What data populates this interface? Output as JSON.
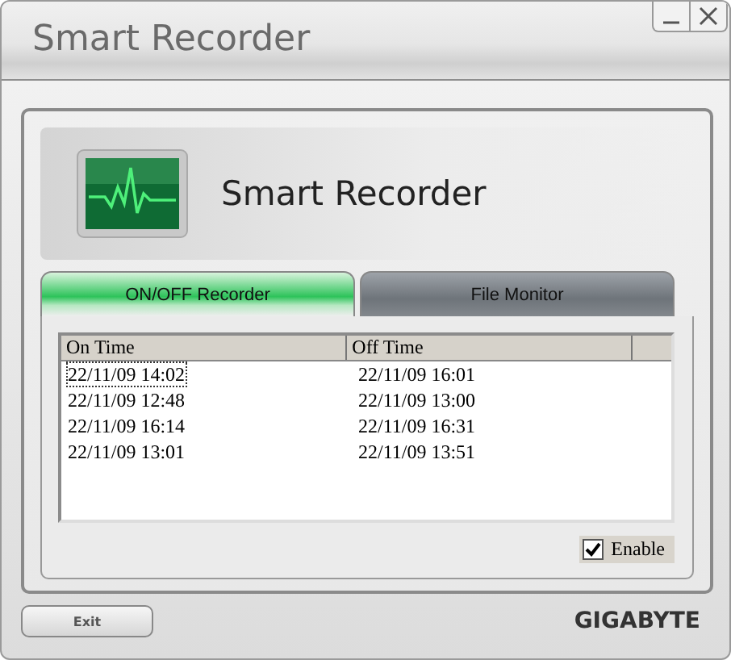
{
  "window": {
    "title": "Smart Recorder"
  },
  "header": {
    "title": "Smart Recorder"
  },
  "tabs": [
    {
      "label": "ON/OFF Recorder",
      "selected": true
    },
    {
      "label": "File Monitor",
      "selected": false
    }
  ],
  "table": {
    "columns": [
      "On Time",
      "Off Time"
    ],
    "rows": [
      {
        "cells": [
          "22/11/09 14:02",
          "22/11/09 16:01"
        ],
        "focused": true
      },
      {
        "cells": [
          "22/11/09 12:48",
          "22/11/09 13:00"
        ],
        "focused": false
      },
      {
        "cells": [
          "22/11/09 16:14",
          "22/11/09 16:31"
        ],
        "focused": false
      },
      {
        "cells": [
          "22/11/09 13:01",
          "22/11/09 13:51"
        ],
        "focused": false
      }
    ]
  },
  "enable": {
    "label": "Enable",
    "checked": true
  },
  "exit_button": "Exit",
  "brand": "GIGABYTE"
}
